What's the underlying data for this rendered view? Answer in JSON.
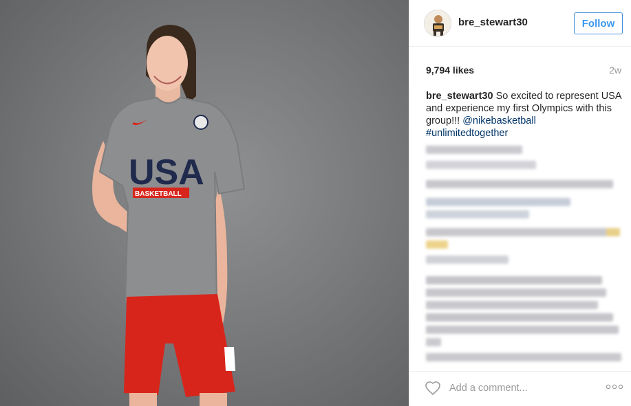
{
  "post": {
    "username": "bre_stewart30",
    "follow_label": "Follow",
    "likes": "9,794 likes",
    "age": "2w",
    "caption": {
      "username": "bre_stewart30",
      "text": "So excited to represent USA and experience my first Olympics with this group!!!",
      "mention": "@nikebasketball",
      "hashtag": "#unlimitedtogether"
    },
    "comment_placeholder": "Add a comment..."
  },
  "photo": {
    "shirt_text": "USA",
    "shirt_subtext": "BASKETBALL"
  },
  "icons": {
    "avatar": "avatar-image",
    "heart": "heart-icon",
    "more": "more-options-icon"
  },
  "colors": {
    "follow_blue": "#3897f0",
    "link_blue": "#003569",
    "text": "#262626",
    "muted": "#999999",
    "usa_navy": "#1f2a4d",
    "shorts_red": "#d8251c"
  }
}
